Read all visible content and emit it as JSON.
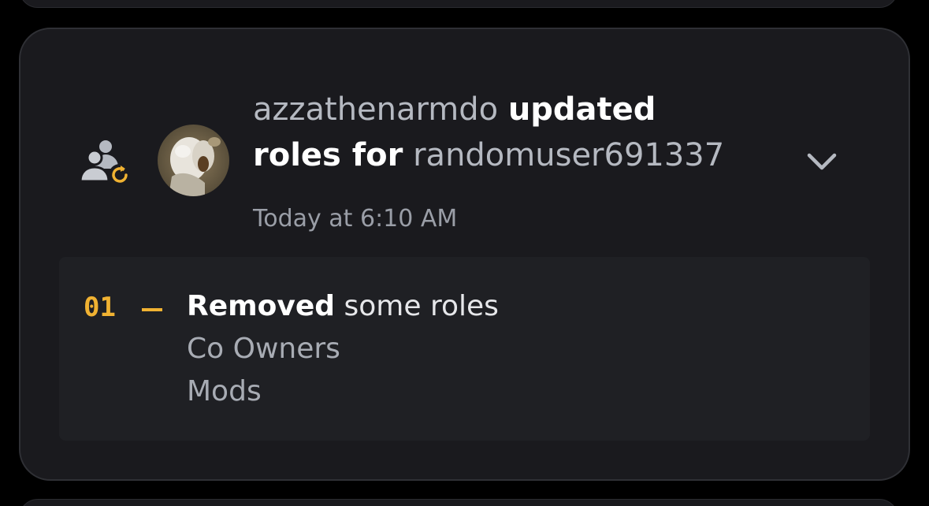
{
  "entry": {
    "actor": "azzathenarmdo",
    "action_part1": "updated",
    "action_part2": "roles for",
    "target": "randomuser691337",
    "timestamp": "Today at 6:10 AM",
    "action_icon": "member-role-update-icon",
    "expand_icon": "chevron-down-icon"
  },
  "changes": [
    {
      "index": "01",
      "verb": "Removed",
      "description": "some roles",
      "roles": [
        "Co Owners",
        "Mods"
      ]
    }
  ],
  "colors": {
    "card_bg": "#1a1a1e",
    "changes_bg": "#1f2024",
    "accent_orange": "#f0b232",
    "muted_text": "#b5b9c1"
  }
}
